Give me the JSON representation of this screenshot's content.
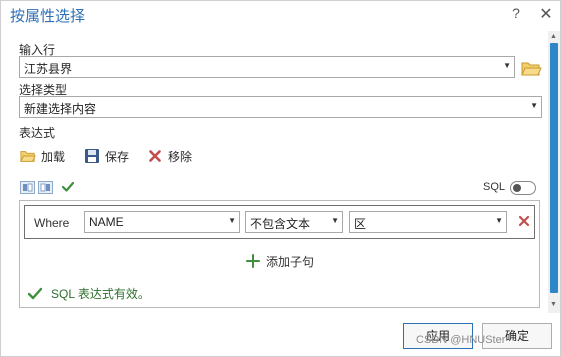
{
  "title": "按属性选择",
  "help_label": "?",
  "close_label": "✕",
  "input_rows": {
    "label": "输入行",
    "value": "江苏县界"
  },
  "selection_type": {
    "label": "选择类型",
    "value": "新建选择内容"
  },
  "expression": {
    "label": "表达式",
    "toolbar": {
      "load": "加载",
      "save": "保存",
      "remove": "移除"
    },
    "sql_label": "SQL",
    "sql_toggle_on": false,
    "clause": {
      "where": "Where",
      "field": "NAME",
      "operator": "不包含文本",
      "value": "区"
    },
    "add_clause": "添加子句"
  },
  "status_text": "SQL 表达式有效。",
  "buttons": {
    "apply": "应用",
    "ok": "确定"
  },
  "watermark": "CSDN @HNUSter",
  "colors": {
    "title": "#2f6fb5",
    "accent": "#2f86c7",
    "valid": "#3f8f3f",
    "remove": "#c0504d",
    "folder": "#e8b84a"
  },
  "icons": {
    "folder": "folder-icon",
    "save": "floppy-disk-icon",
    "remove": "x-icon",
    "check": "checkmark-icon",
    "add": "plus-icon"
  }
}
